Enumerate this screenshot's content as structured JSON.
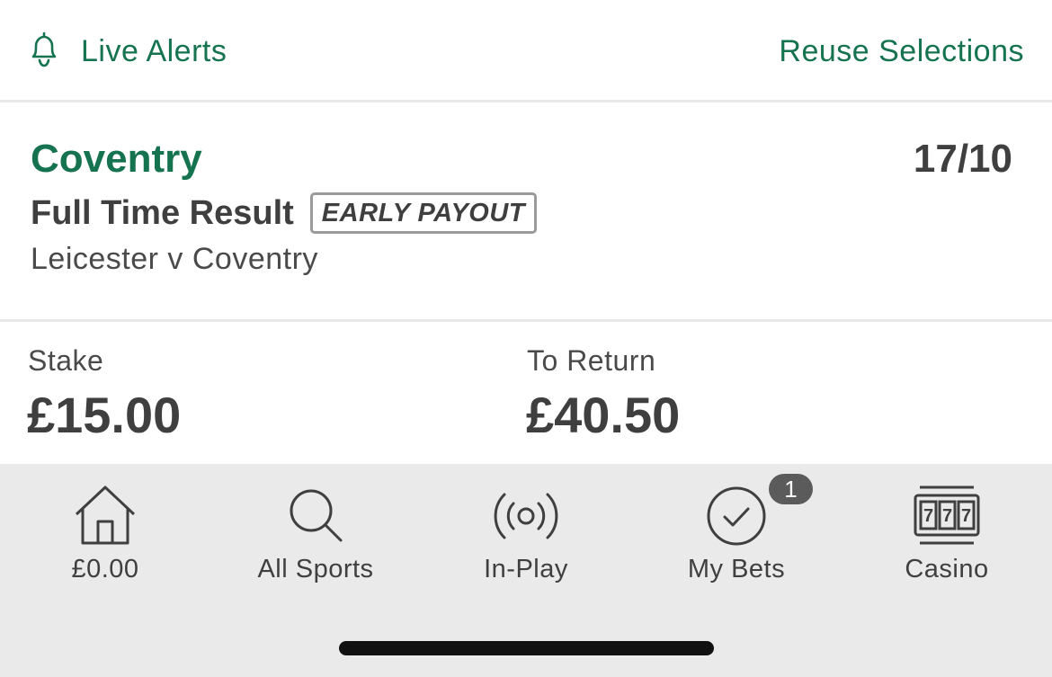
{
  "header": {
    "live_alerts": "Live Alerts",
    "reuse_selections": "Reuse Selections"
  },
  "selection": {
    "name": "Coventry",
    "odds": "17/10",
    "market": "Full Time Result",
    "badge": "EARLY PAYOUT",
    "event": "Leicester v Coventry"
  },
  "bet": {
    "stake_label": "Stake",
    "stake_value": "£15.00",
    "return_label": "To Return",
    "return_value": "£40.50"
  },
  "tabbar": {
    "items": [
      {
        "label": "£0.00",
        "icon": "home-icon"
      },
      {
        "label": "All Sports",
        "icon": "search-icon"
      },
      {
        "label": "In-Play",
        "icon": "broadcast-icon"
      },
      {
        "label": "My Bets",
        "icon": "check-circle-icon"
      },
      {
        "label": "Casino",
        "icon": "slot-machine-icon"
      }
    ],
    "my_bets_count": "1"
  },
  "colors": {
    "accent": "#15734f",
    "text": "#3f3f3f",
    "tabbar_bg": "#e9eae9",
    "badge_bg": "#5b5b5b"
  }
}
